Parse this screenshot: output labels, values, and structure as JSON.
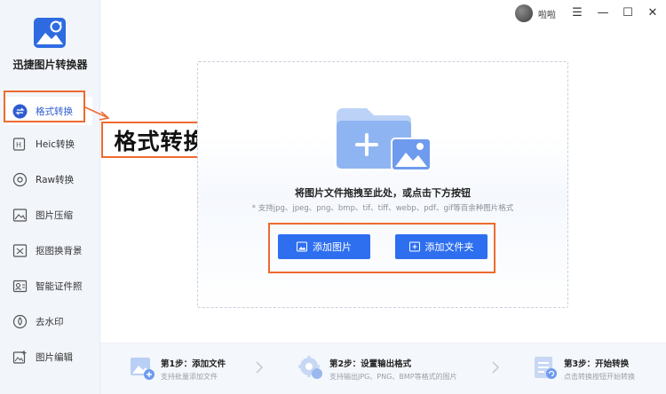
{
  "app": {
    "name": "迅捷图片转换器"
  },
  "user": {
    "name": "啦啦"
  },
  "window_controls": {
    "menu": "☰",
    "minimize": "—",
    "maximize": "☐",
    "close": "✕"
  },
  "sidebar": {
    "items": [
      {
        "label": "格式转换",
        "icon": "format-convert-icon",
        "active": true
      },
      {
        "label": "Heic转换",
        "icon": "heic-icon",
        "active": false
      },
      {
        "label": "Raw转换",
        "icon": "raw-icon",
        "active": false
      },
      {
        "label": "图片压缩",
        "icon": "image-compress-icon",
        "active": false
      },
      {
        "label": "抠图换背景",
        "icon": "cutout-icon",
        "active": false
      },
      {
        "label": "智能证件照",
        "icon": "id-photo-icon",
        "active": false
      },
      {
        "label": "去水印",
        "icon": "watermark-remove-icon",
        "active": false
      },
      {
        "label": "图片编辑",
        "icon": "image-edit-icon",
        "active": false
      }
    ]
  },
  "annotation": {
    "label": "格式转换"
  },
  "dropzone": {
    "title": "将图片文件拖拽至此处，或点击下方按钮",
    "subtitle": "* 支持jpg、jpeg、png、bmp、tif、tiff、webp、pdf、gif等百余种图片格式",
    "add_image_label": "添加图片",
    "add_folder_label": "添加文件夹"
  },
  "steps": [
    {
      "title": "第1步：添加文件",
      "desc": "支持批量添加文件"
    },
    {
      "title": "第2步：设置输出格式",
      "desc": "支持输出JPG、PNG、BMP等格式的图片"
    },
    {
      "title": "第3步：开始转换",
      "desc": "点击转换按钮开始转换"
    }
  ],
  "colors": {
    "accent": "#2e6ff0",
    "annotation": "#ee6a2f",
    "sidebar_bg": "#f2f5fa"
  }
}
